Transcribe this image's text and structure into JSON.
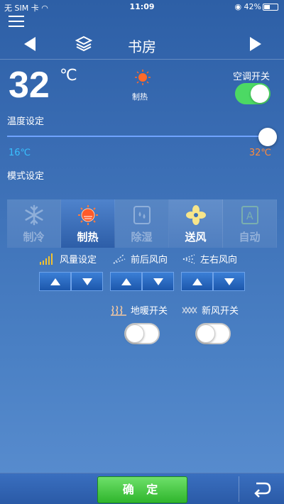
{
  "status_bar": {
    "carrier": "无 SIM 卡",
    "time": "11:09",
    "battery": "42%"
  },
  "header": {
    "room_title": "书房"
  },
  "current": {
    "temperature": "32",
    "unit": "℃",
    "mode_label": "制热"
  },
  "ac_switch": {
    "label": "空调开关",
    "on": true
  },
  "temperature_setting": {
    "label": "温度设定",
    "min_label": "16℃",
    "max_label": "32℃",
    "value": 32,
    "min": 16,
    "max": 32
  },
  "mode_setting": {
    "label": "模式设定",
    "modes": [
      {
        "label": "制冷",
        "icon": "snowflake-icon",
        "state": "disabled"
      },
      {
        "label": "制热",
        "icon": "sun-icon",
        "state": "active"
      },
      {
        "label": "除湿",
        "icon": "droplets-icon",
        "state": "disabled"
      },
      {
        "label": "送风",
        "icon": "fan-icon",
        "state": "enabled"
      },
      {
        "label": "自动",
        "icon": "auto-icon",
        "state": "disabled"
      }
    ]
  },
  "controls": {
    "fan_speed": "风量设定",
    "vertical_swing": "前后风向",
    "horizontal_swing": "左右风向"
  },
  "switches": {
    "floor_heating": {
      "label": "地暖开关",
      "on": false
    },
    "fresh_air": {
      "label": "新风开关",
      "on": false
    }
  },
  "footer": {
    "confirm": "确 定"
  },
  "colors": {
    "accent_green": "#4cd964",
    "min_temp": "#39c0ff",
    "max_temp": "#ff8a3a"
  }
}
